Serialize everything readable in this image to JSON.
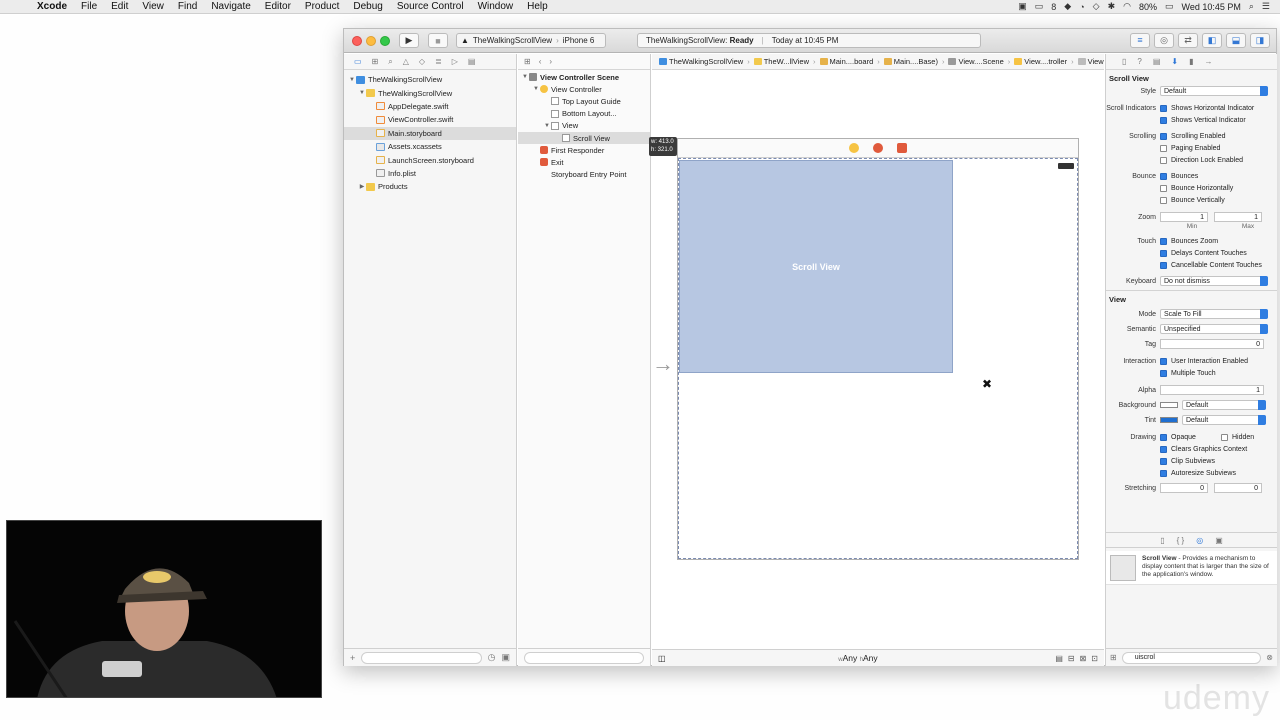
{
  "menubar": {
    "app": "Xcode",
    "items": [
      "File",
      "Edit",
      "View",
      "Find",
      "Navigate",
      "Editor",
      "Product",
      "Debug",
      "Source Control",
      "Window",
      "Help"
    ],
    "battery": "80%",
    "clock": "Wed 10:45 PM",
    "badge_count": "8"
  },
  "toolbar": {
    "scheme_target": "TheWalkingScrollView",
    "scheme_device": "iPhone 6",
    "status_project": "TheWalkingScrollView:",
    "status_state": "Ready",
    "status_time": "Today at 10:45 PM"
  },
  "navigator": {
    "items": [
      {
        "label": "TheWalkingScrollView",
        "indent": 0,
        "icon": "project-icon",
        "disclosure": "▼"
      },
      {
        "label": "TheWalkingScrollView",
        "indent": 1,
        "icon": "folder-icon",
        "disclosure": "▼"
      },
      {
        "label": "AppDelegate.swift",
        "indent": 2,
        "icon": "swift-file-icon",
        "disclosure": ""
      },
      {
        "label": "ViewController.swift",
        "indent": 2,
        "icon": "swift-file-icon",
        "disclosure": ""
      },
      {
        "label": "Main.storyboard",
        "indent": 2,
        "icon": "storyboard-icon",
        "disclosure": "",
        "selected": true
      },
      {
        "label": "Assets.xcassets",
        "indent": 2,
        "icon": "assets-icon",
        "disclosure": ""
      },
      {
        "label": "LaunchScreen.storyboard",
        "indent": 2,
        "icon": "storyboard-icon",
        "disclosure": ""
      },
      {
        "label": "Info.plist",
        "indent": 2,
        "icon": "plist-icon",
        "disclosure": ""
      },
      {
        "label": "Products",
        "indent": 1,
        "icon": "folder-icon",
        "disclosure": "▶"
      }
    ]
  },
  "outline": {
    "items": [
      {
        "label": "View Controller Scene",
        "indent": 0,
        "icon": "scene-icon",
        "disclosure": "▼",
        "bold": true
      },
      {
        "label": "View Controller",
        "indent": 1,
        "icon": "view-controller-icon",
        "disclosure": "▼"
      },
      {
        "label": "Top Layout Guide",
        "indent": 2,
        "icon": "layout-guide-icon",
        "disclosure": ""
      },
      {
        "label": "Bottom Layout...",
        "indent": 2,
        "icon": "layout-guide-icon",
        "disclosure": ""
      },
      {
        "label": "View",
        "indent": 2,
        "icon": "view-icon",
        "disclosure": "▼"
      },
      {
        "label": "Scroll View",
        "indent": 3,
        "icon": "scroll-view-icon",
        "disclosure": "",
        "selected": true
      },
      {
        "label": "First Responder",
        "indent": 1,
        "icon": "first-responder-icon",
        "disclosure": ""
      },
      {
        "label": "Exit",
        "indent": 1,
        "icon": "exit-icon",
        "disclosure": ""
      },
      {
        "label": "Storyboard Entry Point",
        "indent": 1,
        "icon": "entry-point-icon",
        "disclosure": ""
      }
    ]
  },
  "jumpbar": {
    "crumbs": [
      "TheWalkingScrollView",
      "TheW...llView",
      "Main....board",
      "Main....Base)",
      "View....Scene",
      "View....troller",
      "View",
      "Scroll View"
    ]
  },
  "canvas": {
    "scrollview_label": "Scroll View",
    "size_badge_w": "413.0",
    "size_badge_h": "321.0",
    "size_class_w_prefix": "w",
    "size_class_w": "Any",
    "size_class_h_prefix": "h",
    "size_class_h": "Any"
  },
  "inspector": {
    "section_title": "Scroll View",
    "style_label": "Style",
    "style_value": "Default",
    "scroll_indicators_label": "Scroll Indicators",
    "show_horizontal": "Shows Horizontal Indicator",
    "show_vertical": "Shows Vertical Indicator",
    "scrolling_label": "Scrolling",
    "scrolling_enabled": "Scrolling Enabled",
    "paging_enabled": "Paging Enabled",
    "direction_lock": "Direction Lock Enabled",
    "bounce_label": "Bounce",
    "bounces": "Bounces",
    "bounce_h": "Bounce Horizontally",
    "bounce_v": "Bounce Vertically",
    "zoom_label": "Zoom",
    "zoom_min": "1",
    "zoom_max": "1",
    "min_caption": "Min",
    "max_caption": "Max",
    "touch_label": "Touch",
    "bounces_zoom": "Bounces Zoom",
    "delays_touches": "Delays Content Touches",
    "cancellable_touches": "Cancellable Content Touches",
    "keyboard_label": "Keyboard",
    "keyboard_value": "Do not dismiss",
    "view_section": "View",
    "mode_label": "Mode",
    "mode_value": "Scale To Fill",
    "semantic_label": "Semantic",
    "semantic_value": "Unspecified",
    "tag_label": "Tag",
    "tag_value": "0",
    "interaction_label": "Interaction",
    "user_interaction": "User Interaction Enabled",
    "multiple_touch": "Multiple Touch",
    "alpha_label": "Alpha",
    "alpha_value": "1",
    "background_label": "Background",
    "background_value": "Default",
    "tint_label": "Tint",
    "tint_value": "Default",
    "drawing_label": "Drawing",
    "opaque": "Opaque",
    "hidden": "Hidden",
    "clears_context": "Clears Graphics Context",
    "clip_subviews": "Clip Subviews",
    "autoresize_subviews": "Autoresize Subviews",
    "stretching_label": "Stretching",
    "stretching_x": "0",
    "stretching_y": "0"
  },
  "library": {
    "item_title": "Scroll View",
    "item_desc": " - Provides a mechanism to display content that is larger than the size of the application's window.",
    "filter_value": "uiscrol"
  },
  "colors": {
    "accent": "#2f7de1",
    "scrollview_fill": "#b7c7e2",
    "tint_swatch": "#1f6fd1"
  }
}
